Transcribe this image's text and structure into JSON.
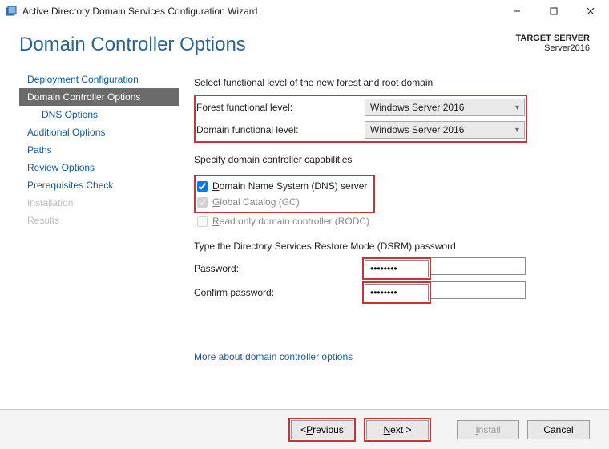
{
  "titlebar": {
    "title": "Active Directory Domain Services Configuration Wizard"
  },
  "header": {
    "page_title": "Domain Controller Options",
    "target_server_label": "TARGET SERVER",
    "target_server_value": "Server2016"
  },
  "sidebar": {
    "items": [
      {
        "label": "Deployment Configuration",
        "state": "normal"
      },
      {
        "label": "Domain Controller Options",
        "state": "selected"
      },
      {
        "label": "DNS Options",
        "state": "sub"
      },
      {
        "label": "Additional Options",
        "state": "normal"
      },
      {
        "label": "Paths",
        "state": "normal"
      },
      {
        "label": "Review Options",
        "state": "normal"
      },
      {
        "label": "Prerequisites Check",
        "state": "normal"
      },
      {
        "label": "Installation",
        "state": "disabled"
      },
      {
        "label": "Results",
        "state": "disabled"
      }
    ]
  },
  "main": {
    "func_level_text": "Select functional level of the new forest and root domain",
    "forest_label": "Forest functional level:",
    "forest_value": "Windows Server 2016",
    "domain_label": "Domain functional level:",
    "domain_value": "Windows Server 2016",
    "capabilities_text": "Specify domain controller capabilities",
    "cap_dns": "omain Name System (DNS) server",
    "cap_dns_u": "D",
    "cap_gc": "lobal Catalog (GC)",
    "cap_gc_u": "G",
    "cap_rodc": "ead only domain controller (RODC)",
    "cap_rodc_u": "R",
    "dsrm_text": "Type the Directory Services Restore Mode (DSRM) password",
    "password_label_pre": "Passwor",
    "password_label_u": "d",
    "password_label_post": ":",
    "password_value": "••••••••",
    "confirm_label_pre": "",
    "confirm_label_u": "C",
    "confirm_label_post": "onfirm password:",
    "confirm_value": "••••••••",
    "more_link": "More about domain controller options"
  },
  "footer": {
    "previous_pre": "< ",
    "previous_u": "P",
    "previous_post": "revious",
    "next_u": "N",
    "next_post": "ext >",
    "install_u": "I",
    "install_post": "nstall",
    "cancel": "Cancel"
  }
}
